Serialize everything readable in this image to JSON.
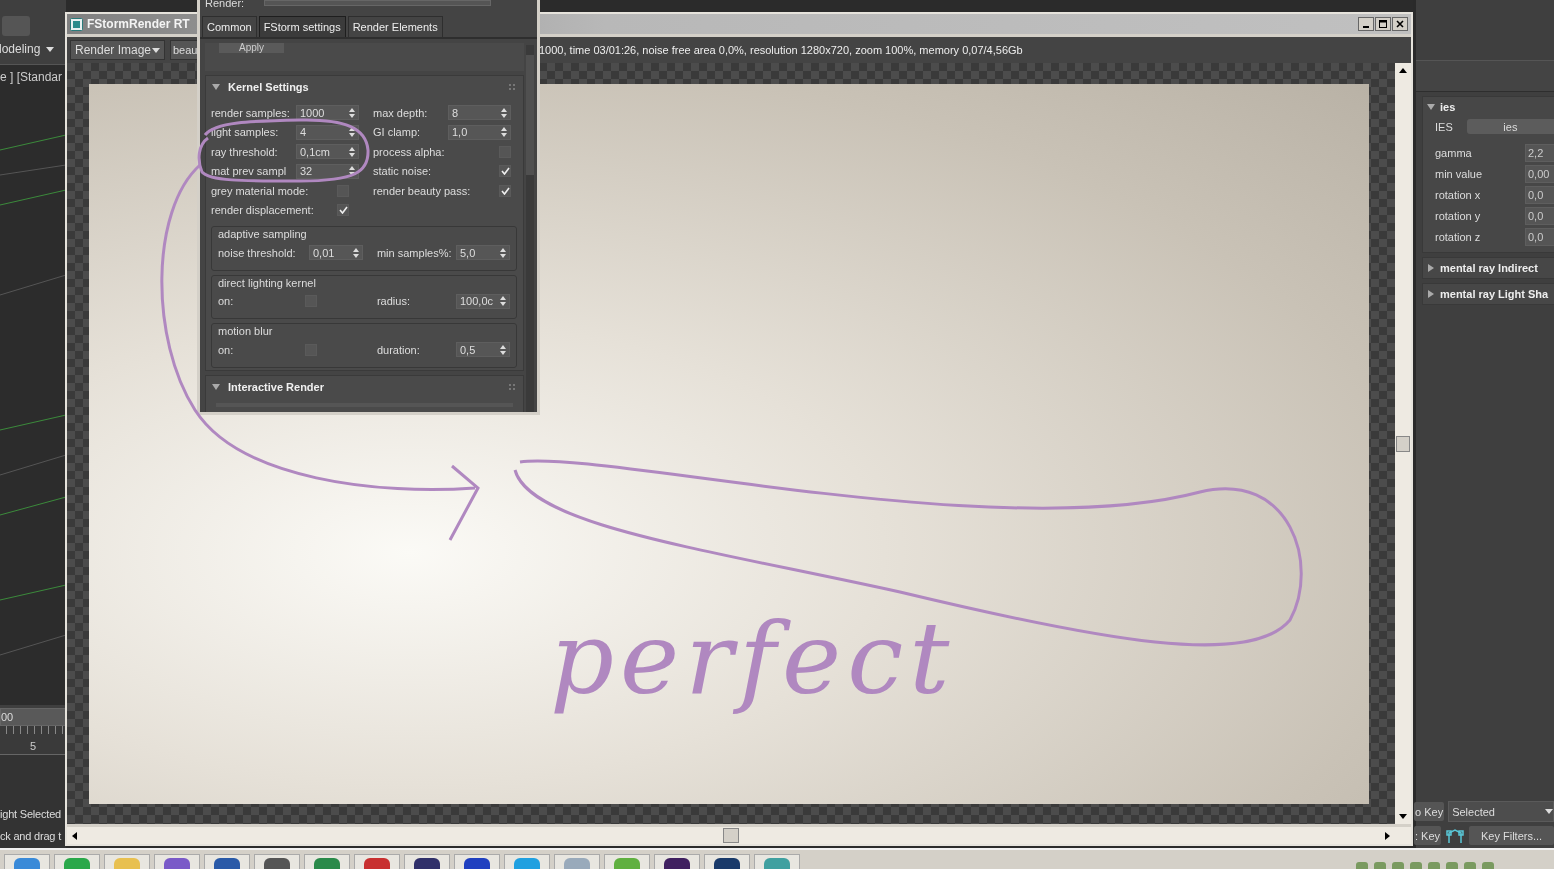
{
  "left_app": {
    "workspace_dropdown": "lodeling",
    "viewport_label": "e ] [Standar",
    "timeline_field": "00",
    "timeline_tick": "5",
    "status_lines": [
      "ight Selected",
      "ck and drag t"
    ]
  },
  "render_window": {
    "title": "FStormRender RT",
    "channel_dropdown": "Render Image",
    "field": "beau",
    "status": "1000, time 03/01:26, noise free area 0,0%, resolution 1280x720, zoom 100%, memory 0,07/4,56Gb"
  },
  "render_setup": {
    "label": "Render:",
    "tabs": [
      {
        "label": "Common",
        "selected": false
      },
      {
        "label": "FStorm settings",
        "selected": true
      },
      {
        "label": "Render Elements",
        "selected": false
      }
    ],
    "apply_button": "Apply",
    "kernel": {
      "title": "Kernel Settings",
      "expanded": true,
      "columns": [
        [
          {
            "kind": "spinner",
            "label": "render samples:",
            "value": "1000"
          },
          {
            "kind": "spinner",
            "label": "light samples:",
            "value": "4"
          },
          {
            "kind": "spinner",
            "label": "ray threshold:",
            "value": "0,1cm"
          },
          {
            "kind": "spinner",
            "label": "mat prev sampl",
            "value": "32"
          },
          {
            "kind": "checkbox",
            "label": "grey material mode:",
            "checked": false
          },
          {
            "kind": "checkbox",
            "label": "render displacement:",
            "checked": true
          }
        ],
        [
          {
            "kind": "spinner",
            "label": "max depth:",
            "value": "8"
          },
          {
            "kind": "spinner",
            "label": "GI clamp:",
            "value": "1,0"
          },
          {
            "kind": "checkbox",
            "label": "process alpha:",
            "checked": false
          },
          {
            "kind": "checkbox",
            "label": "static noise:",
            "checked": true
          },
          {
            "kind": "checkbox",
            "label": "render beauty pass:",
            "checked": true
          }
        ]
      ],
      "groups": [
        {
          "title": "adaptive sampling",
          "fields": [
            {
              "kind": "spinner",
              "label": "noise threshold:",
              "value": "0,01"
            },
            {
              "kind": "spinner",
              "label": "min samples%:",
              "value": "5,0"
            }
          ]
        },
        {
          "title": "direct lighting kernel",
          "fields": [
            {
              "kind": "checkbox",
              "label": "on:",
              "checked": false
            },
            {
              "kind": "spinner",
              "label": "radius:",
              "value": "100,0c"
            }
          ]
        },
        {
          "title": "motion blur",
          "fields": [
            {
              "kind": "checkbox",
              "label": "on:",
              "checked": false
            },
            {
              "kind": "spinner",
              "label": "duration:",
              "value": "0,5"
            }
          ]
        }
      ]
    },
    "next_rollout": {
      "title": "Interactive Render",
      "expanded": true
    }
  },
  "right_panel": {
    "rollouts": [
      {
        "title": "ies",
        "expanded": true,
        "ies_label": "IES",
        "ies_button": "ies",
        "params": [
          {
            "label": "gamma",
            "value": "2,2"
          },
          {
            "label": "min value",
            "value": "0,00"
          },
          {
            "label": "rotation x",
            "value": "0,0"
          },
          {
            "label": "rotation y",
            "value": "0,0"
          },
          {
            "label": "rotation z",
            "value": "0,0"
          }
        ]
      },
      {
        "title": "mental ray Indirect",
        "expanded": false
      },
      {
        "title": "mental ray Light Sha",
        "expanded": false
      }
    ],
    "auto_key_button": "o Key",
    "selection_dropdown": "Selected",
    "set_key_button": ": Key",
    "key_filters_button": "Key Filters..."
  },
  "annotation": {
    "text": "perfect"
  }
}
